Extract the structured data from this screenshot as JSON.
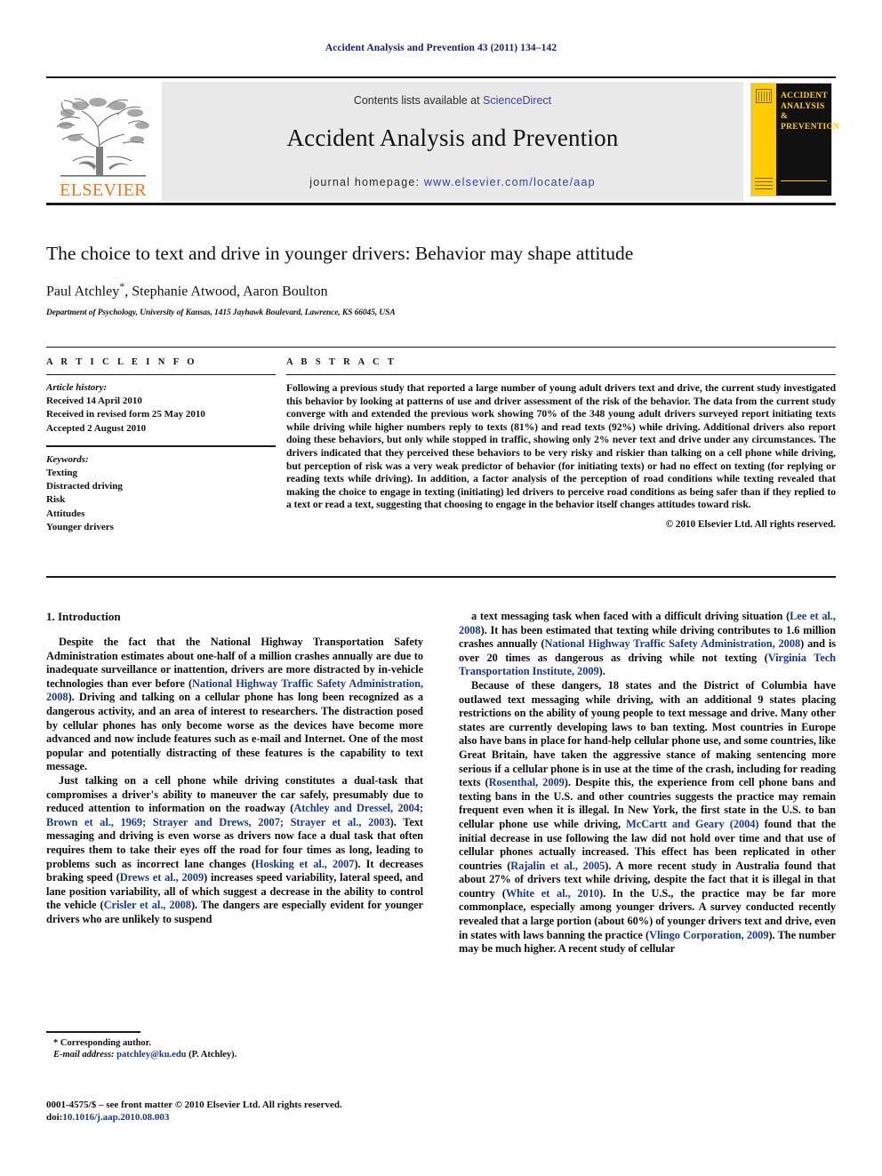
{
  "running_head": "Accident Analysis and Prevention 43 (2011) 134–142",
  "masthead": {
    "publisher_logo_text": "ELSEVIER",
    "contents_prefix": "Contents lists available at ",
    "contents_link": "ScienceDirect",
    "journal_title": "Accident Analysis and Prevention",
    "homepage_prefix": "journal homepage: ",
    "homepage_url": "www.elsevier.com/locate/aap",
    "cover_title_lines": [
      "ACCIDENT",
      "ANALYSIS",
      "&",
      "PREVENTION"
    ],
    "accent_yellow": "#FFCC00",
    "elsevier_orange": "#E87722",
    "link_blue": "#3a3fa0"
  },
  "article": {
    "title": "The choice to text and drive in younger drivers: Behavior may shape attitude",
    "authors": "Paul Atchley",
    "authors_rest": ", Stephanie Atwood, Aaron Boulton",
    "corresponding_marker": "*",
    "affiliation": "Department of Psychology, University of Kansas, 1415 Jayhawk Boulevard, Lawrence, KS 66045, USA"
  },
  "article_info": {
    "heading": "A R T I C L E    I N F O",
    "history_label": "Article history:",
    "history": [
      "Received 14 April 2010",
      "Received in revised form 25 May 2010",
      "Accepted 2 August 2010"
    ],
    "keywords_label": "Keywords:",
    "keywords": [
      "Texting",
      "Distracted driving",
      "Risk",
      "Attitudes",
      "Younger drivers"
    ]
  },
  "abstract": {
    "heading": "A B S T R A C T",
    "text": "Following a previous study that reported a large number of young adult drivers text and drive, the current study investigated this behavior by looking at patterns of use and driver assessment of the risk of the behavior. The data from the current study converge with and extended the previous work showing 70% of the 348 young adult drivers surveyed report initiating texts while driving while higher numbers reply to texts (81%) and read texts (92%) while driving. Additional drivers also report doing these behaviors, but only while stopped in traffic, showing only 2% never text and drive under any circumstances. The drivers indicated that they perceived these behaviors to be very risky and riskier than talking on a cell phone while driving, but perception of risk was a very weak predictor of behavior (for initiating texts) or had no effect on texting (for replying or reading texts while driving). In addition, a factor analysis of the perception of road conditions while texting revealed that making the choice to engage in texting (initiating) led drivers to perceive road conditions as being safer than if they replied to a text or read a text, suggesting that choosing to engage in the behavior itself changes attitudes toward risk.",
    "copyright": "© 2010 Elsevier Ltd. All rights reserved."
  },
  "body": {
    "section_number_title": "1.  Introduction",
    "left_paragraphs": [
      {
        "parts": [
          {
            "t": "Despite the fact that the National Highway Transportation Safety Administration estimates about one-half of a million crashes annually are due to inadequate surveillance or inattention, drivers are more distracted by in-vehicle technologies than ever before ("
          },
          {
            "t": "National Highway Traffic Safety Administration, 2008",
            "ref": true
          },
          {
            "t": "). Driving and talking on a cellular phone has long been recognized as a dangerous activity, and an area of interest to researchers. The distraction posed by cellular phones has only become worse as the devices have become more advanced and now include features such as e-mail and Internet. One of the most popular and potentially distracting of these features is the capability to text message."
          }
        ]
      },
      {
        "parts": [
          {
            "t": "Just talking on a cell phone while driving constitutes a dual-task that compromises a driver's ability to maneuver the car safely, presumably due to reduced attention to information on the roadway ("
          },
          {
            "t": "Atchley and Dressel, 2004; Brown et al., 1969; Strayer and Drews, 2007; Strayer et al., 2003",
            "ref": true
          },
          {
            "t": "). Text messaging and driving is even worse as drivers now face a dual task that often requires them to take their eyes off the road for four times as long, leading to problems such as incorrect lane changes ("
          },
          {
            "t": "Hosking et al., 2007",
            "ref": true
          },
          {
            "t": "). It decreases braking speed ("
          },
          {
            "t": "Drews et al., 2009",
            "ref": true
          },
          {
            "t": ") increases speed variability, lateral speed, and lane position variability, all of which suggest a decrease in the ability to control the vehicle ("
          },
          {
            "t": "Crisler et al., 2008",
            "ref": true
          },
          {
            "t": "). The dangers are especially evident for younger drivers who are unlikely to suspend"
          }
        ]
      }
    ],
    "right_paragraphs": [
      {
        "parts": [
          {
            "t": "a text messaging task when faced with a difficult driving situation ("
          },
          {
            "t": "Lee et al., 2008",
            "ref": true
          },
          {
            "t": "). It has been estimated that texting while driving contributes to 1.6 million crashes annually ("
          },
          {
            "t": "National Highway Traffic Safety Administration, 2008",
            "ref": true
          },
          {
            "t": ") and is over 20 times as dangerous as driving while not texting ("
          },
          {
            "t": "Virginia Tech Transportation Institute, 2009",
            "ref": true
          },
          {
            "t": ")."
          }
        ]
      },
      {
        "parts": [
          {
            "t": "Because of these dangers, 18 states and the District of Columbia have outlawed text messaging while driving, with an additional 9 states placing restrictions on the ability of young people to text message and drive. Many other states are currently developing laws to ban texting. Most countries in Europe also have bans in place for hand-help cellular phone use, and some countries, like Great Britain, have taken the aggressive stance of making sentencing more serious if a cellular phone is in use at the time of the crash, including for reading texts ("
          },
          {
            "t": "Rosenthal, 2009",
            "ref": true
          },
          {
            "t": "). Despite this, the experience from cell phone bans and texting bans in the U.S. and other countries suggests the practice may remain frequent even when it is illegal. In New York, the first state in the U.S. to ban cellular phone use while driving, "
          },
          {
            "t": "McCartt and Geary (2004)",
            "ref": true
          },
          {
            "t": " found that the initial decrease in use following the law did not hold over time and that use of cellular phones actually increased. This effect has been replicated in other countries ("
          },
          {
            "t": "Rajalin et al., 2005",
            "ref": true
          },
          {
            "t": "). A more recent study in Australia found that about 27% of drivers text while driving, despite the fact that it is illegal in that country ("
          },
          {
            "t": "White et al., 2010",
            "ref": true
          },
          {
            "t": "). In the U.S., the practice may be far more commonplace, especially among younger drivers. A survey conducted recently revealed that a large portion (about 60%) of younger drivers text and drive, even in states with laws banning the practice ("
          },
          {
            "t": "Vlingo Corporation, 2009",
            "ref": true
          },
          {
            "t": "). The number may be much higher. A recent study of cellular"
          }
        ]
      }
    ]
  },
  "footnote": {
    "corresponding": "* Corresponding author.",
    "email_label": "E-mail address: ",
    "email": "patchley@ku.edu",
    "email_suffix": " (P. Atchley)."
  },
  "footer": {
    "issn_line": "0001-4575/$ – see front matter © 2010 Elsevier Ltd. All rights reserved.",
    "doi_label": "doi:",
    "doi": "10.1016/j.aap.2010.08.003"
  }
}
